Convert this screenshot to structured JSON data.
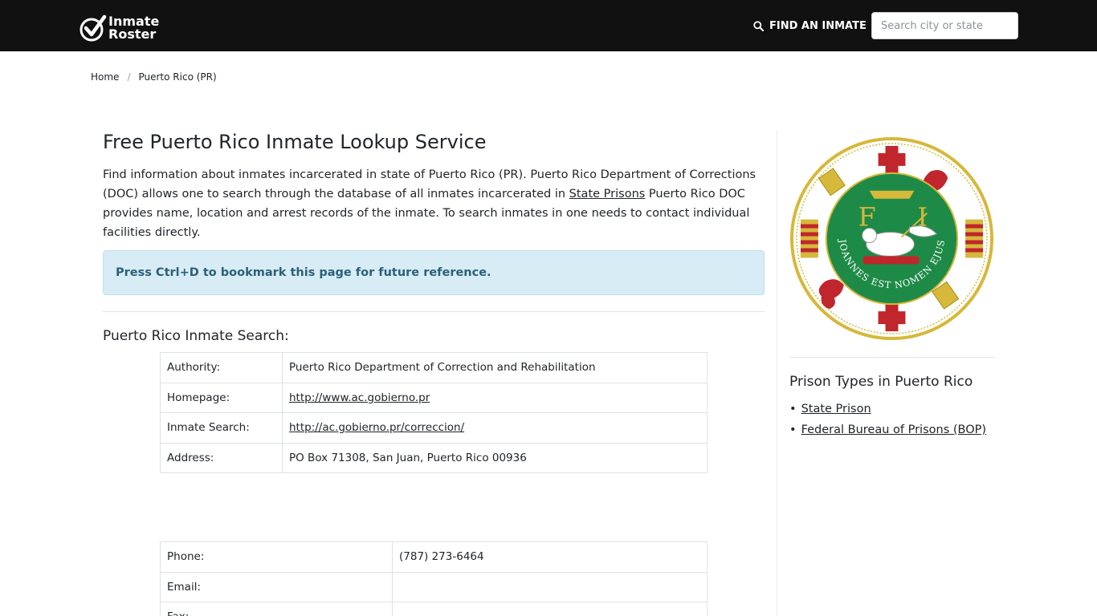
{
  "nav": {
    "logo_line1": "Inmate",
    "logo_line2": "Roster",
    "find_label": "FIND AN INMATE",
    "search_placeholder": "Search city or state"
  },
  "breadcrumb": {
    "home": "Home",
    "separator": "/",
    "current": "Puerto Rico (PR)"
  },
  "main": {
    "title": "Free Puerto Rico Inmate Lookup Service",
    "intro_before": "Find information about inmates incarcerated in state of Puerto Rico (PR). Puerto Rico Department of Corrections (DOC) allows one to search through the database of all inmates incarcerated in ",
    "intro_link": "State Prisons",
    "intro_after": " Puerto Rico DOC provides name, location and arrest records of the inmate. To search inmates in one needs to contact individual facilities directly.",
    "alert": "Press Ctrl+D to bookmark this page for future reference.",
    "search_heading": "Puerto Rico Inmate Search:"
  },
  "info_table": [
    {
      "key": "Authority:",
      "value": "Puerto Rico Department of Correction and Rehabilitation"
    },
    {
      "key": "Homepage:",
      "value": "http://www.ac.gobierno.pr"
    },
    {
      "key": "Inmate Search:",
      "value": "http://ac.gobierno.pr/correccion/"
    },
    {
      "key": "Address:",
      "value": "PO Box 71308, San Juan, Puerto Rico 00936"
    }
  ],
  "contact_table": [
    {
      "key": "Phone:",
      "value": "(787) 273-6464"
    },
    {
      "key": "Email:",
      "value": ""
    },
    {
      "key": "Fax:",
      "value": ""
    }
  ],
  "sidebar": {
    "seal_motto": "JOANNES EST NOMEN EJUS",
    "seal_letter_left": "F",
    "seal_letter_right": "I",
    "title": "Prison Types in Puerto Rico",
    "links": [
      "State Prison",
      "Federal Bureau of Prisons (BOP)"
    ]
  },
  "colors": {
    "navbar_bg": "#111111",
    "alert_bg": "#d7ecf5",
    "alert_text": "#2c6079",
    "seal_green": "#1e8a47",
    "seal_gold": "#d6b83a",
    "seal_red": "#c0262b"
  }
}
